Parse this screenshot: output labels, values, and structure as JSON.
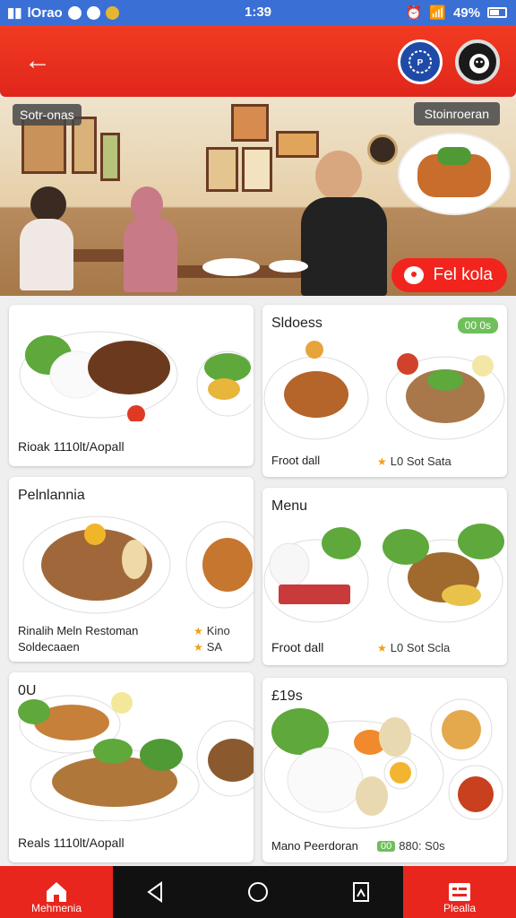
{
  "status_bar": {
    "left_text": "lOrao",
    "time": "1:39",
    "battery": "49%"
  },
  "header": {},
  "hero": {
    "label_left": "Sotr-onas",
    "label_right": "Stoinroeran",
    "cta_label": "Fel kola"
  },
  "cards": [
    {
      "title": "",
      "caption": "Rioak 1110lt/Aopall"
    },
    {
      "title": "Sldoess",
      "badge": "00 0s",
      "caption": "Froot dall",
      "meta": "L0 Sot Sata"
    },
    {
      "title": "Pelnlannia",
      "caption": "Rinalih Meln Restoman",
      "caption2": "Soldecaaen",
      "meta": "Kino",
      "meta2": "SA"
    },
    {
      "title": "Menu",
      "caption": "Froot dall",
      "meta": "L0 Sot Scla"
    },
    {
      "title": "0U",
      "caption": "Reals 1110lt/Aopall"
    },
    {
      "title": "£19s",
      "caption": "Mano Peerdoran",
      "meta_badge": "00",
      "meta": "880: S0s"
    }
  ],
  "bottom_nav": {
    "home_label": "Mehmenia",
    "right_label": "Plealla"
  },
  "colors": {
    "brand_red": "#e8261d",
    "status_blue": "#3a6fd6",
    "badge_green": "#6fbf5a"
  }
}
